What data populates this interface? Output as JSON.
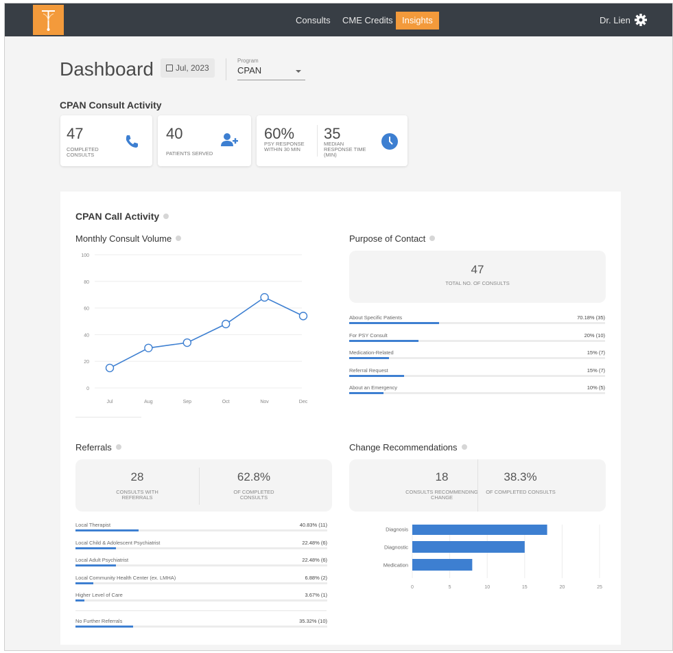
{
  "nav": {
    "consults": "Consults",
    "cme": "CME Credits",
    "insights": "Insights",
    "user": "Dr. Lien"
  },
  "header": {
    "title": "Dashboard",
    "date": "Jul, 2023",
    "program_label": "Program",
    "program_value": "CPAN"
  },
  "consult_activity": {
    "heading": "CPAN Consult Activity",
    "completed": {
      "value": "47",
      "label": "Completed Consults"
    },
    "patients": {
      "value": "40",
      "label": "Patients Served"
    },
    "psy": {
      "value": "60%",
      "label": "PSY Response within 30 min"
    },
    "median": {
      "value": "35",
      "label": "Median Response Time (min)"
    }
  },
  "call_activity": {
    "heading": "CPAN Call Activity",
    "monthly_title": "Monthly Consult Volume",
    "purpose_title": "Purpose of Contact",
    "purpose_total": "47",
    "purpose_total_label": "Total No. of Consults",
    "purpose_items": [
      {
        "label": "About Specific Patients",
        "value": "70.18% (35)",
        "pct": 35
      },
      {
        "label": "For PSY Consult",
        "value": "20% (10)",
        "pct": 27
      },
      {
        "label": "Medication-Related",
        "value": "15% (7)",
        "pct": 15.5
      },
      {
        "label": "Referral Request",
        "value": "15% (7)",
        "pct": 21.5
      },
      {
        "label": "About an Emergency",
        "value": "10% (5)",
        "pct": 13.5
      }
    ]
  },
  "referrals": {
    "title": "Referrals",
    "count": "28",
    "count_label": "Consults with Referrals",
    "pct": "62.8%",
    "pct_label": "of Completed Consults",
    "items": [
      {
        "label": "Local Therapist",
        "value": "40.83% (11)",
        "pct": 25
      },
      {
        "label": "Local Child & Adolescent Psychiatrist",
        "value": "22.48% (6)",
        "pct": 16
      },
      {
        "label": "Local Adult Psychiatrist",
        "value": "22.48% (6)",
        "pct": 16
      },
      {
        "label": "Local Community Health Center (ex. LMHA)",
        "value": "6.88% (2)",
        "pct": 7
      },
      {
        "label": "Higher Level of Care",
        "value": "3.67% (1)",
        "pct": 3.5
      },
      {
        "label": "No Further Referrals",
        "value": "35.32% (10)",
        "pct": 23
      }
    ]
  },
  "change_recs": {
    "title": "Change Recommendations",
    "count": "18",
    "count_label": "Consults Recommending Change",
    "pct": "38.3%",
    "pct_label": "of Completed Consults"
  },
  "colors": {
    "topbar": "#383e45",
    "accent": "#f39a3b",
    "blue": "#3d7fd1"
  },
  "icons": [
    "logo-icon",
    "gear-icon",
    "calendar-icon",
    "phone-icon",
    "add-user-icon",
    "clock-icon",
    "info-icon",
    "chevron-down-icon"
  ],
  "chart_data": [
    {
      "type": "line",
      "title": "Monthly Consult Volume",
      "categories": [
        "Jul",
        "Aug",
        "Sep",
        "Oct",
        "Nov",
        "Dec"
      ],
      "values": [
        15,
        30,
        34,
        48,
        68,
        54
      ],
      "ylim": [
        0,
        100
      ],
      "yticks": [
        0,
        20,
        40,
        60,
        80,
        100
      ],
      "grid": true
    },
    {
      "type": "bar",
      "orientation": "horizontal",
      "title": "Change Recommendations",
      "categories": [
        "Diagnosis",
        "Diagnostic",
        "Medication"
      ],
      "values": [
        18,
        15,
        8
      ],
      "xlim": [
        0,
        25
      ],
      "xticks": [
        0,
        5,
        10,
        15,
        20,
        25
      ],
      "grid": true
    }
  ]
}
